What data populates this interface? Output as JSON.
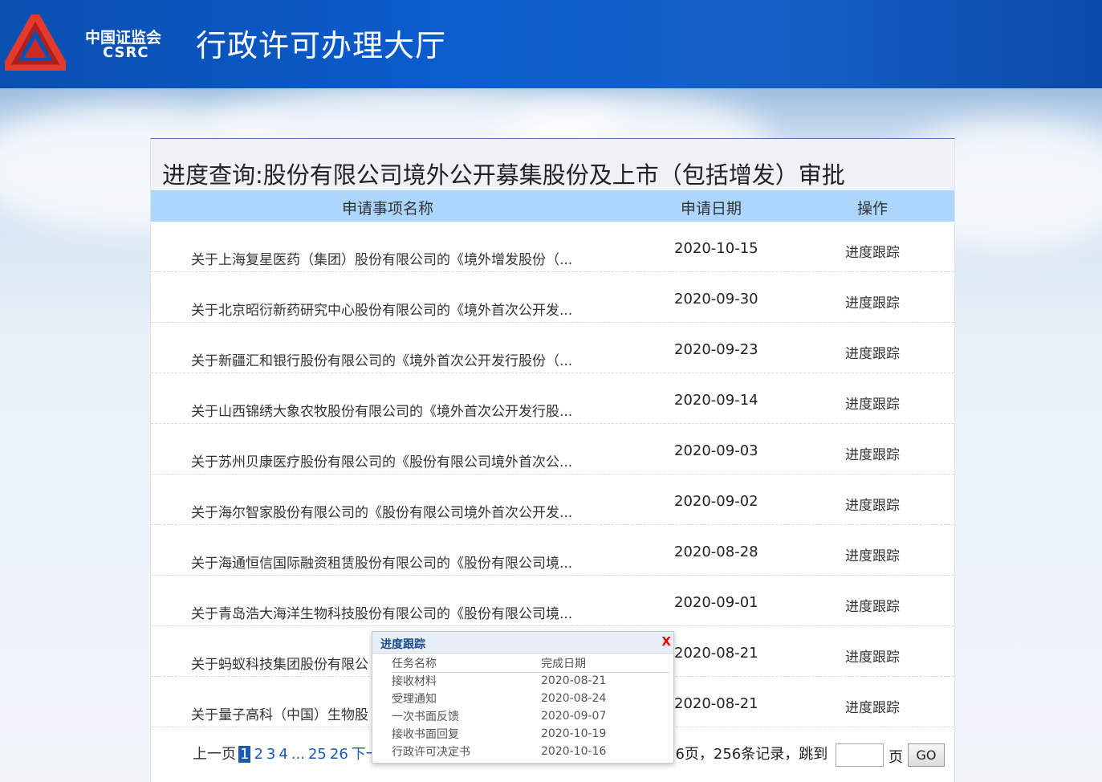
{
  "header": {
    "logo_cn": "中国证监会",
    "logo_en": "CSRC",
    "title": "行政许可办理大厅"
  },
  "panel": {
    "title": "进度查询:股份有限公司境外公开募集股份及上市（包括增发）审批",
    "columns": [
      "申请事项名称",
      "申请日期",
      "操作"
    ],
    "rows": [
      {
        "name": "关于上海复星医药（集团）股份有限公司的《境外增发股份（...",
        "date": "2020-10-15",
        "op": "进度跟踪"
      },
      {
        "name": "关于北京昭衍新药研究中心股份有限公司的《境外首次公开发...",
        "date": "2020-09-30",
        "op": "进度跟踪"
      },
      {
        "name": "关于新疆汇和银行股份有限公司的《境外首次公开发行股份（...",
        "date": "2020-09-23",
        "op": "进度跟踪"
      },
      {
        "name": "关于山西锦绣大象农牧股份有限公司的《境外首次公开发行股...",
        "date": "2020-09-14",
        "op": "进度跟踪"
      },
      {
        "name": "关于苏州贝康医疗股份有限公司的《股份有限公司境外首次公...",
        "date": "2020-09-03",
        "op": "进度跟踪"
      },
      {
        "name": "关于海尔智家股份有限公司的《股份有限公司境外首次公开发...",
        "date": "2020-09-02",
        "op": "进度跟踪"
      },
      {
        "name": "关于海通恒信国际融资租赁股份有限公司的《股份有限公司境...",
        "date": "2020-08-28",
        "op": "进度跟踪"
      },
      {
        "name": "关于青岛浩大海洋生物科技股份有限公司的《股份有限公司境...",
        "date": "2020-09-01",
        "op": "进度跟踪"
      },
      {
        "name": "关于蚂蚁科技集团股份有限公",
        "date": "2020-08-21",
        "op": "进度跟踪"
      },
      {
        "name": "关于量子高科（中国）生物股",
        "date": "2020-08-21",
        "op": "进度跟踪"
      }
    ]
  },
  "pager": {
    "prev": "上一页",
    "current": "1",
    "pages": [
      "2",
      "3",
      "4"
    ],
    "ellipsis": "...",
    "tail_pages": [
      "25",
      "26"
    ],
    "next": "下一页",
    "summary": "共26页，256条记录，跳到",
    "unit": "页",
    "go": "GO"
  },
  "popup": {
    "title": "进度跟踪",
    "close": "X",
    "header": {
      "task": "任务名称",
      "date": "完成日期"
    },
    "items": [
      {
        "task": "接收材料",
        "date": "2020-08-21"
      },
      {
        "task": "受理通知",
        "date": "2020-08-24"
      },
      {
        "task": "一次书面反馈",
        "date": "2020-09-07"
      },
      {
        "task": "接收书面回复",
        "date": "2020-10-19"
      },
      {
        "task": "行政许可决定书",
        "date": "2020-10-16"
      }
    ]
  },
  "colors": {
    "header_blue": "#0b5ccc",
    "table_header": "#acd6fd",
    "link_blue": "#1a5ab4",
    "close_red": "#e00000"
  }
}
